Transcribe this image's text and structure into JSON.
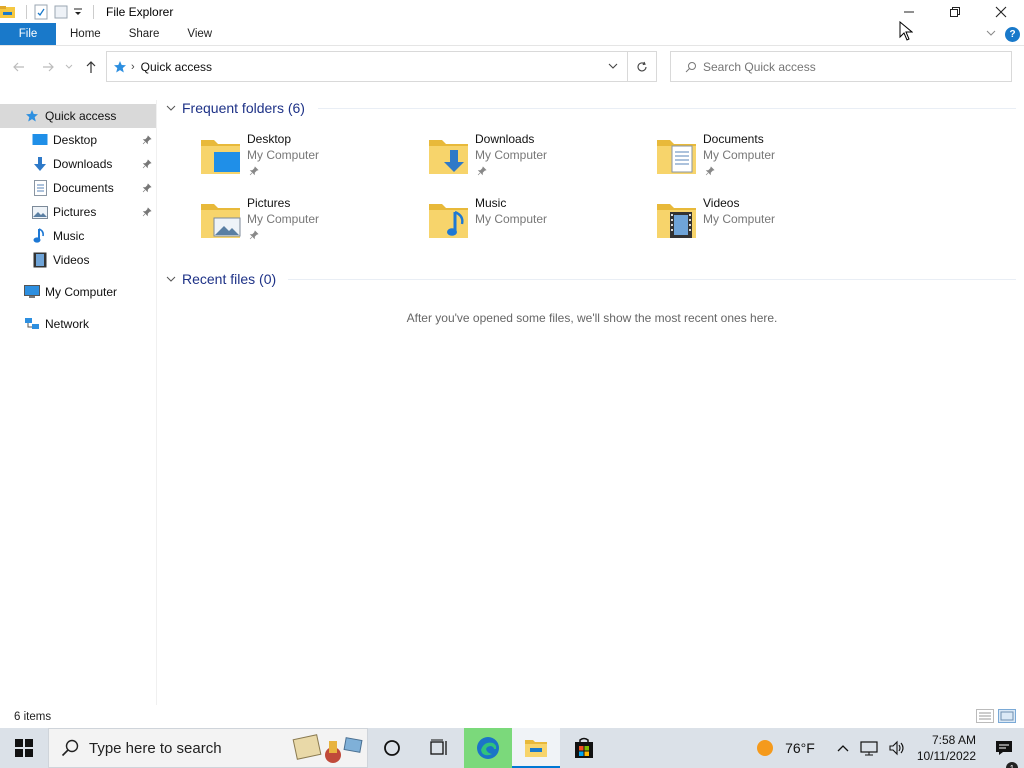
{
  "window": {
    "title": "File Explorer"
  },
  "ribbon": {
    "tabs": [
      {
        "label": "File",
        "active": true
      },
      {
        "label": "Home"
      },
      {
        "label": "Share"
      },
      {
        "label": "View"
      }
    ],
    "help_label": "?"
  },
  "address": {
    "path": "Quick access"
  },
  "search": {
    "placeholder": "Search Quick access"
  },
  "nav_pane": {
    "items": [
      {
        "label": "Quick access",
        "icon": "star-icon",
        "selected": true
      },
      {
        "label": "Desktop",
        "icon": "desktop-icon",
        "pinned": true
      },
      {
        "label": "Downloads",
        "icon": "downloads-icon",
        "pinned": true
      },
      {
        "label": "Documents",
        "icon": "documents-icon",
        "pinned": true
      },
      {
        "label": "Pictures",
        "icon": "pictures-icon",
        "pinned": true
      },
      {
        "label": "Music",
        "icon": "music-icon"
      },
      {
        "label": "Videos",
        "icon": "videos-icon"
      },
      {
        "label": "My Computer",
        "icon": "computer-icon"
      },
      {
        "label": "Network",
        "icon": "network-icon"
      }
    ]
  },
  "frequent": {
    "header": "Frequent folders (6)",
    "folders": [
      {
        "name": "Desktop",
        "location": "My Computer",
        "pinned": true,
        "icon": "desktop-folder-icon"
      },
      {
        "name": "Downloads",
        "location": "My Computer",
        "pinned": true,
        "icon": "downloads-folder-icon"
      },
      {
        "name": "Documents",
        "location": "My Computer",
        "pinned": true,
        "icon": "documents-folder-icon"
      },
      {
        "name": "Pictures",
        "location": "My Computer",
        "pinned": true,
        "icon": "pictures-folder-icon"
      },
      {
        "name": "Music",
        "location": "My Computer",
        "pinned": false,
        "icon": "music-folder-icon"
      },
      {
        "name": "Videos",
        "location": "My Computer",
        "pinned": false,
        "icon": "videos-folder-icon"
      }
    ]
  },
  "recent": {
    "header": "Recent files (0)",
    "empty_message": "After you've opened some files, we'll show the most recent ones here."
  },
  "status": {
    "item_count": "6 items"
  },
  "taskbar": {
    "search_placeholder": "Type here to search",
    "weather": "76°F",
    "time": "7:58 AM",
    "date": "10/11/2022",
    "notification_count": "1"
  },
  "colors": {
    "accent": "#1979ca",
    "folder": "#f5c842",
    "taskbar": "#dbe1e8",
    "group_header": "#1e3287"
  }
}
